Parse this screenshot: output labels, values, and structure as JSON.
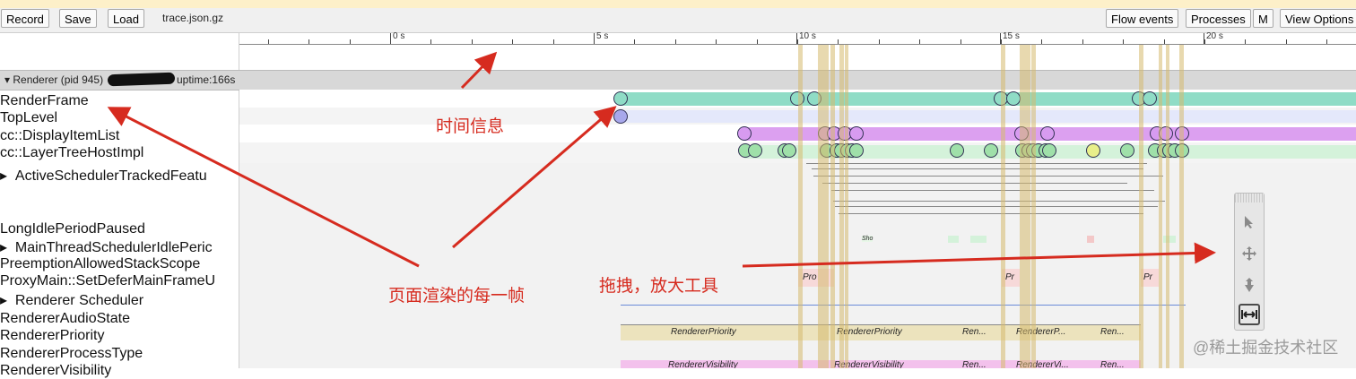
{
  "toolbar": {
    "record_label": "Record",
    "save_label": "Save",
    "load_label": "Load",
    "filename": "trace.json.gz",
    "flow_events_label": "Flow events",
    "processes_label": "Processes",
    "m_label": "M",
    "view_options_label": "View Options"
  },
  "ruler": {
    "ticks": [
      "0 s",
      "5 s",
      "10 s",
      "15 s",
      "20 s"
    ]
  },
  "process": {
    "label": "Renderer (pid 945)",
    "uptime": "uptime:166s"
  },
  "tracks": {
    "render_frame": "RenderFrame",
    "top_level": "TopLevel",
    "display_item_list": "cc::DisplayItemList",
    "layer_tree_host_impl": "cc::LayerTreeHostImpl",
    "active_scheduler": "ActiveSchedulerTrackedFeatu",
    "long_idle": "LongIdlePeriodPaused",
    "main_thread_scheduler": "MainThreadSchedulerIdlePeric",
    "preemption": "PreemptionAllowedStackScope",
    "proxy_main": "ProxyMain::SetDeferMainFrameU",
    "renderer_scheduler": "Renderer Scheduler",
    "renderer_audio_state": "RendererAudioState",
    "renderer_priority": "RendererPriority",
    "renderer_process_type": "RendererProcessType",
    "renderer_visibility": "RendererVisibility"
  },
  "slices": {
    "priority": [
      "RendererPriority",
      "RendererPriority",
      "Ren...",
      "RendererP...",
      "Ren..."
    ],
    "visibility": [
      "RendererVisibility",
      "RendererVisibility",
      "Ren...",
      "RendererVi...",
      "Ren..."
    ],
    "pro": [
      "Pro",
      "Pr",
      "Pr"
    ],
    "sho": "Sho"
  },
  "annotations": {
    "time_info": "时间信息",
    "each_frame": "页面渲染的每一帧",
    "drag_zoom": "拖拽，放大工具"
  },
  "watermark": "@稀土掘金技术社区",
  "colors": {
    "annotation": "#d62b1f",
    "render_frame": "#8fdcc6",
    "display_list": "#dca0f0",
    "layer_tree": "#bfeec9",
    "frame_column": "#d8c47a"
  },
  "icons": [
    "select-arrow-icon",
    "pan-icon",
    "zoom-icon",
    "timing-icon"
  ]
}
